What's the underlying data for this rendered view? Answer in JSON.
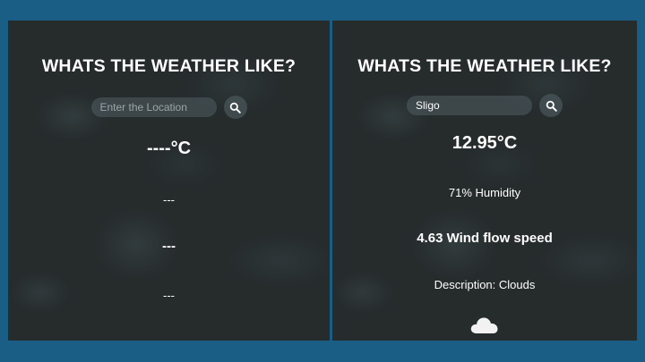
{
  "left_panel": {
    "title": "WHATS THE WEATHER LIKE?",
    "search_placeholder": "Enter the Location",
    "search_value": "",
    "temperature": "----°C",
    "humidity": "---",
    "wind": "---",
    "description": "---"
  },
  "right_panel": {
    "title": "WHATS THE WEATHER LIKE?",
    "search_placeholder": "Enter the Location",
    "search_value": "Sligo",
    "temperature": "12.95°C",
    "humidity": "71% Humidity",
    "wind": "4.63 Wind flow speed",
    "description": "Description: Clouds",
    "weather_icon": "cloud-icon"
  },
  "icons": {
    "search": "search-icon"
  },
  "colors": {
    "background": "#1b5e85",
    "panel": "#262b2c",
    "text": "#ffffff"
  }
}
